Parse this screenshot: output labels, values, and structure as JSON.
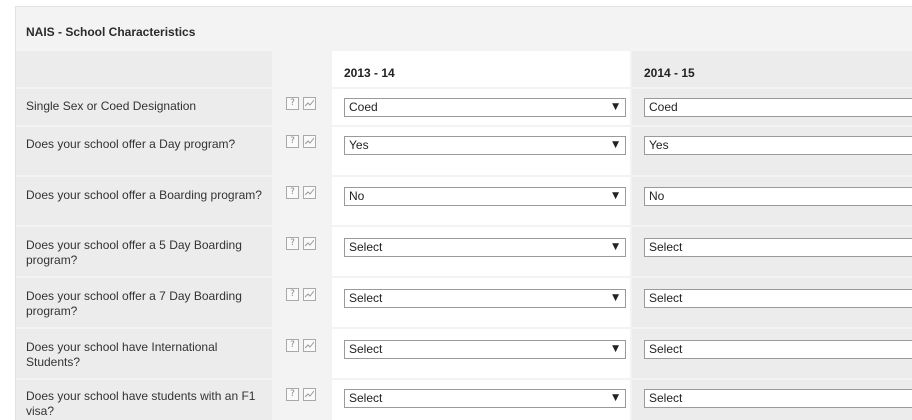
{
  "panel": {
    "title": "NAIS - School Characteristics"
  },
  "columns": {
    "year1": "2013 - 14",
    "year2": "2014 - 15"
  },
  "icons": {
    "help": "?",
    "chart": "chart-icon"
  },
  "rows": [
    {
      "label": "Single Sex or Coed Designation",
      "year1": "Coed",
      "year2": "Coed"
    },
    {
      "label": "Does your school offer a Day program?",
      "year1": "Yes",
      "year2": "Yes"
    },
    {
      "label": "Does your school offer a Boarding program?",
      "year1": "No",
      "year2": "No"
    },
    {
      "label": "Does your school offer a 5 Day Boarding program?",
      "year1": "Select",
      "year2": "Select"
    },
    {
      "label": "Does your school offer a 7 Day Boarding program?",
      "year1": "Select",
      "year2": "Select"
    },
    {
      "label": "Does your school have International Students?",
      "year1": "Select",
      "year2": "Select"
    },
    {
      "label": "Does your school have students with an F1 visa?",
      "year1": "Select",
      "year2": "Select"
    }
  ]
}
